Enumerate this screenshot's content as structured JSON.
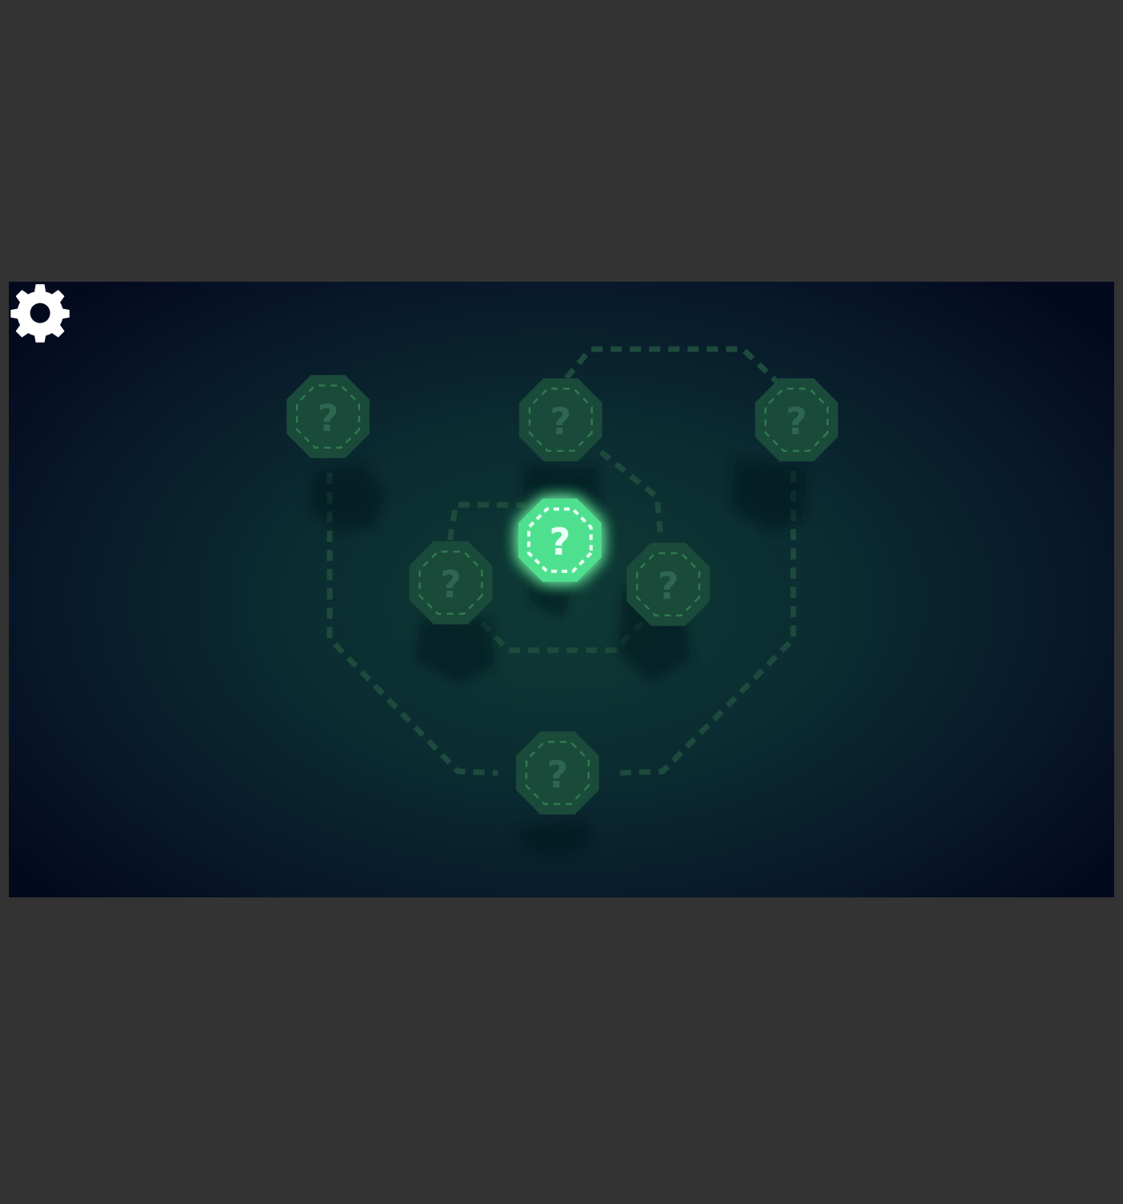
{
  "level_map": {
    "nodes": [
      {
        "id": "node-top-left",
        "label": "?",
        "state": "locked"
      },
      {
        "id": "node-top-center",
        "label": "?",
        "state": "locked"
      },
      {
        "id": "node-top-right",
        "label": "?",
        "state": "locked"
      },
      {
        "id": "node-center",
        "label": "?",
        "state": "active"
      },
      {
        "id": "node-mid-left",
        "label": "?",
        "state": "locked"
      },
      {
        "id": "node-mid-right",
        "label": "?",
        "state": "locked"
      },
      {
        "id": "node-bottom",
        "label": "?",
        "state": "locked"
      }
    ]
  },
  "settings": {
    "icon": "gear-icon"
  },
  "colors": {
    "outer_background": "#333333",
    "node_locked": "#1a4a3a",
    "node_active": "#4fe08f",
    "path": "#1d4a3c",
    "gear": "#ffffff"
  }
}
